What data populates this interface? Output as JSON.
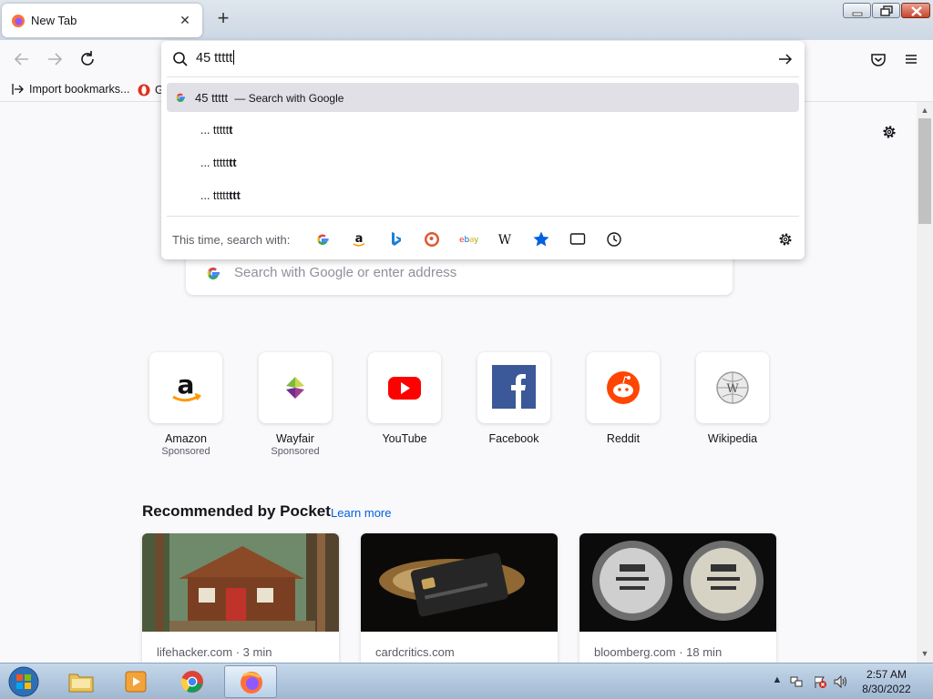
{
  "tab": {
    "title": "New Tab",
    "close_icon": "close-icon"
  },
  "bookmarks": {
    "import_label": "Import bookmarks...",
    "second_label": "G"
  },
  "urlbar": {
    "value": "45 ttttt",
    "heuristic": {
      "query": "45 ttttt",
      "action": "— Search with Google"
    },
    "suggestions": [
      {
        "prefix": "... ttttt",
        "bold": "t"
      },
      {
        "prefix": "... ttttt",
        "bold": "tt"
      },
      {
        "prefix": "... ttttt",
        "bold": "ttt"
      }
    ],
    "oneoff_label": "This time, search with:",
    "oneoff_engines": [
      "google-icon",
      "amazon-icon",
      "bing-icon",
      "duckduckgo-icon",
      "ebay-icon",
      "wikipedia-icon",
      "bookmarks-star-icon",
      "tabs-icon",
      "history-icon",
      "gear-icon"
    ]
  },
  "page_search": {
    "placeholder": "Search with Google or enter address"
  },
  "top_sites": [
    {
      "name": "Amazon",
      "sponsored": "Sponsored"
    },
    {
      "name": "Wayfair",
      "sponsored": "Sponsored"
    },
    {
      "name": "YouTube",
      "sponsored": ""
    },
    {
      "name": "Facebook",
      "sponsored": ""
    },
    {
      "name": "Reddit",
      "sponsored": ""
    },
    {
      "name": "Wikipedia",
      "sponsored": ""
    }
  ],
  "pocket": {
    "title": "Recommended by Pocket",
    "learn_more": "Learn more",
    "cards": [
      {
        "source": "lifehacker.com · 3 min"
      },
      {
        "source": "cardcritics.com"
      },
      {
        "source": "bloomberg.com · 18 min"
      }
    ]
  },
  "taskbar": {
    "time": "2:57 AM",
    "date": "8/30/2022"
  },
  "colors": {
    "accent": "#0061e0",
    "selected_row": "#e0e0e6",
    "firefox_orange": "#ff7139"
  }
}
